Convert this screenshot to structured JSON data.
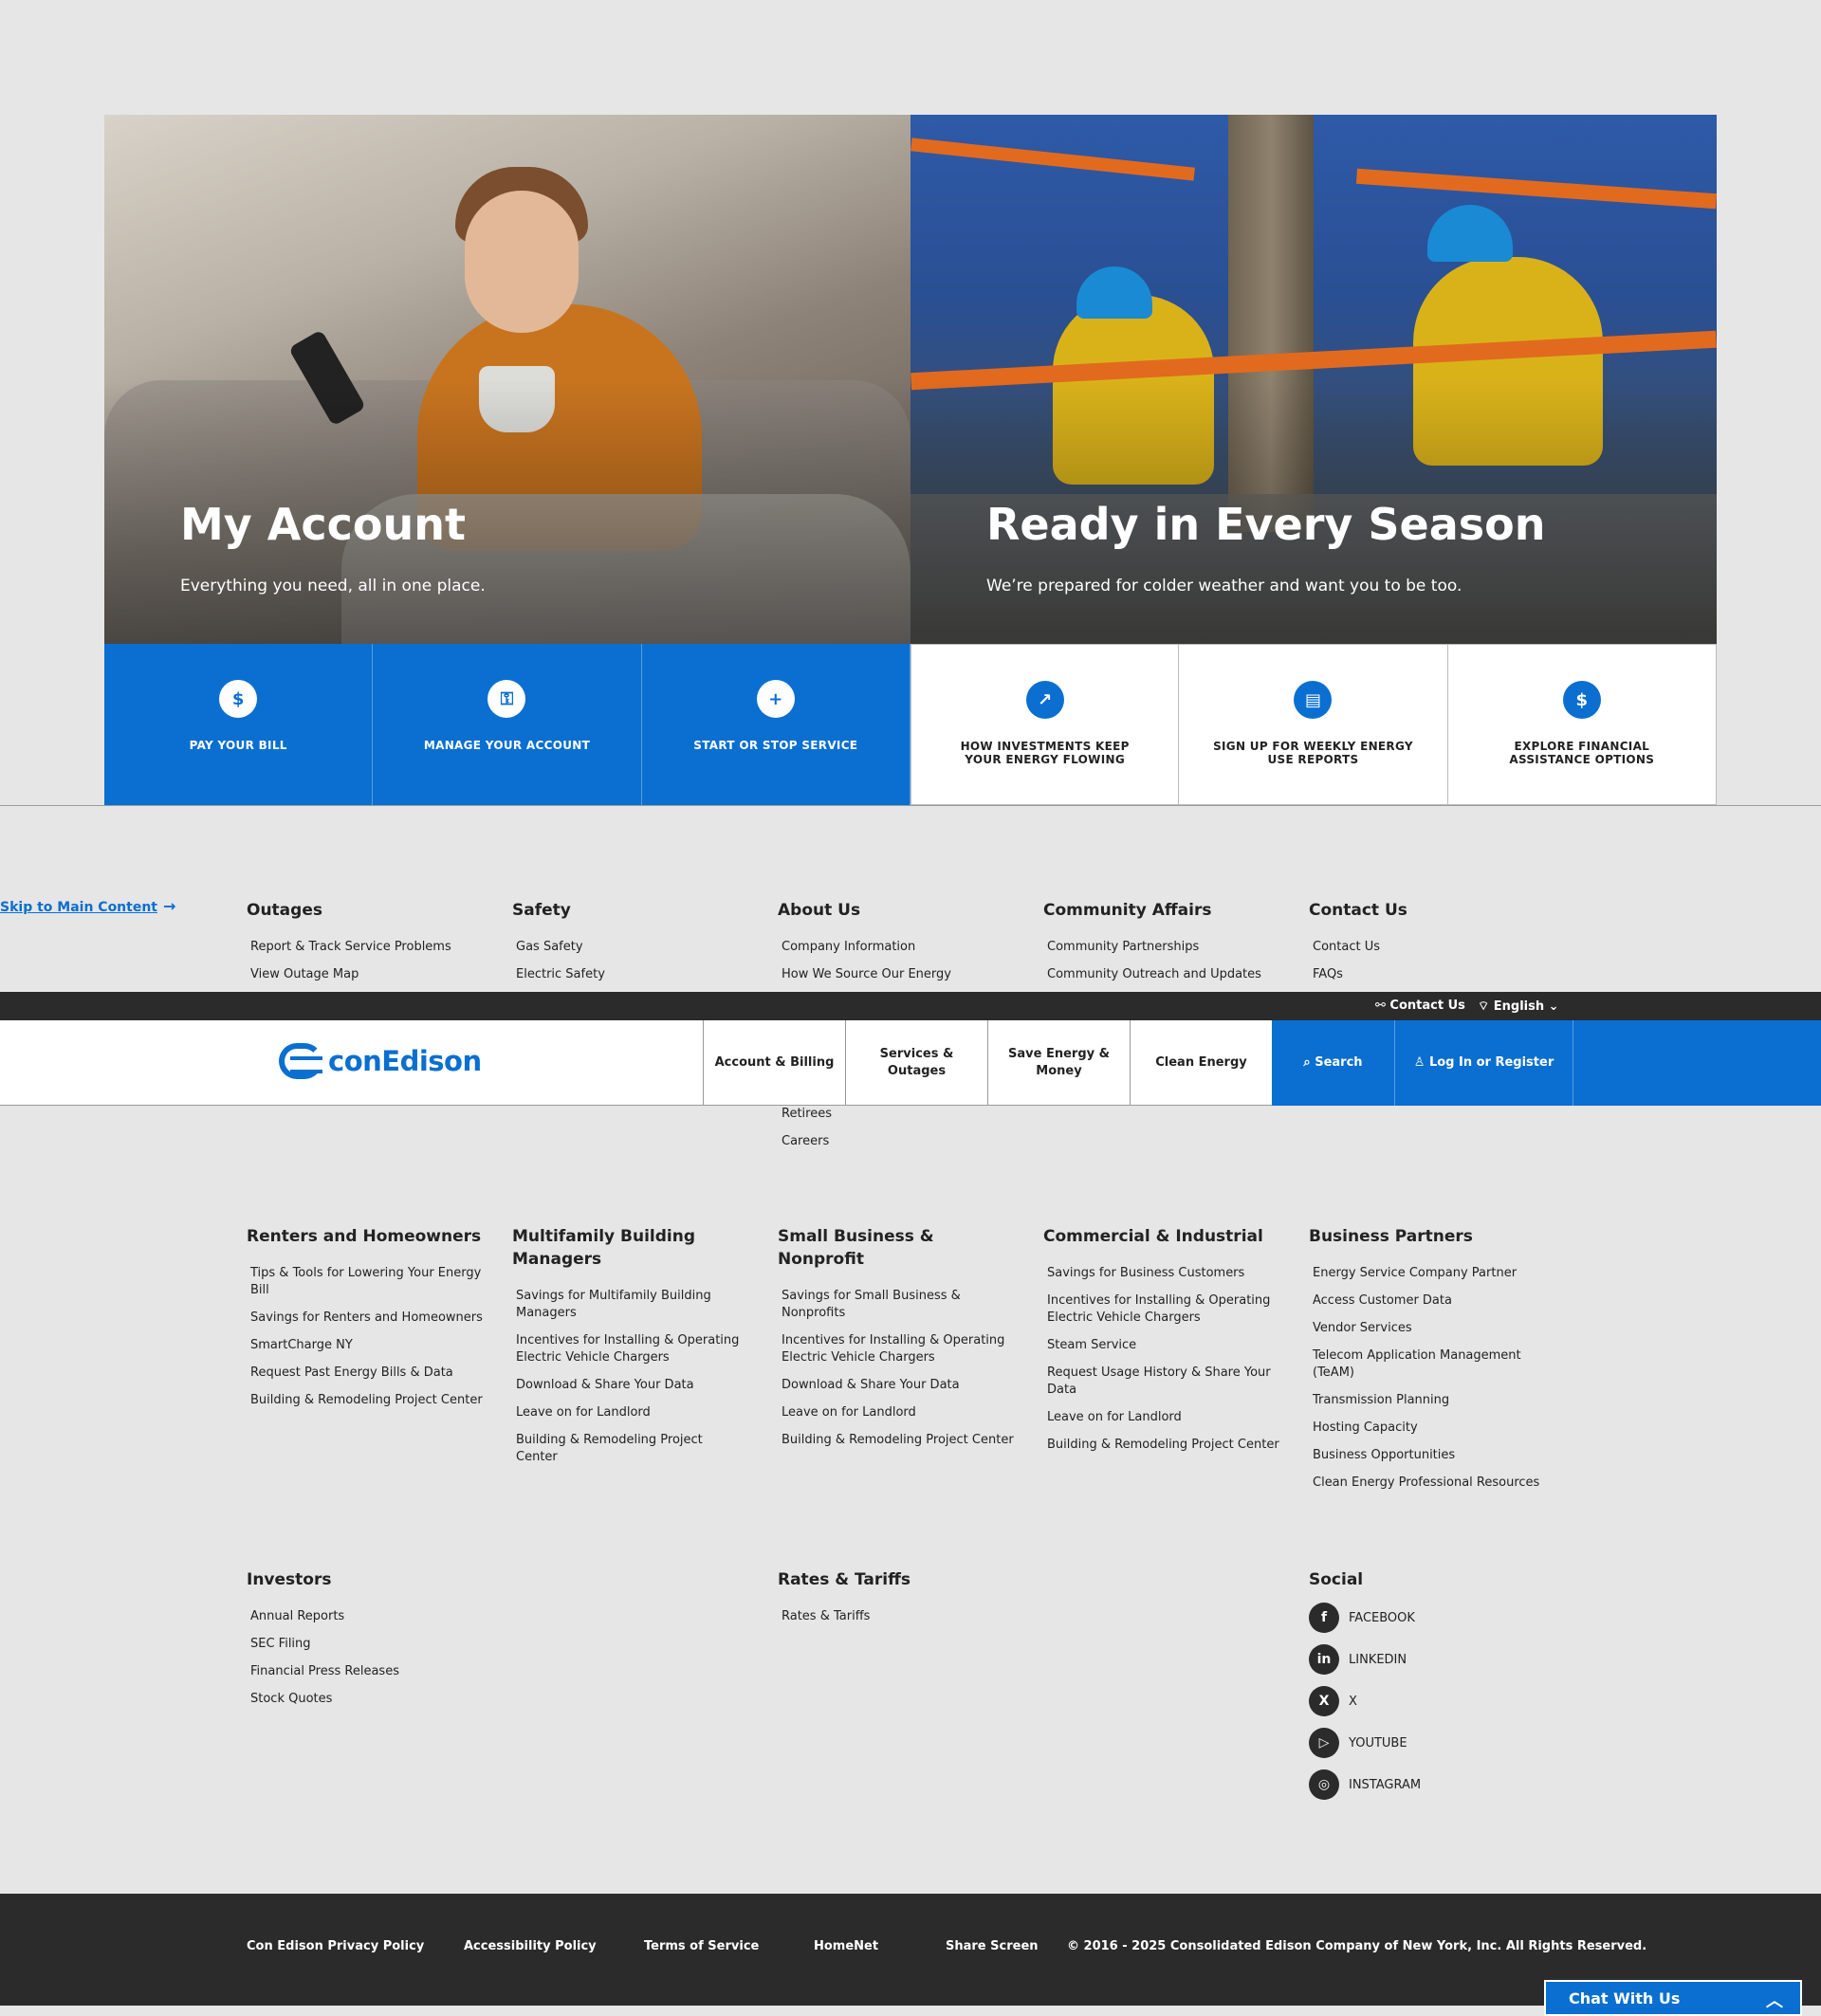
{
  "hero": {
    "left": {
      "title": "My Account",
      "subtitle": "Everything you need, all in one place."
    },
    "right": {
      "title": "Ready in Every Season",
      "subtitle": "We’re prepared for colder weather and want you to be too."
    }
  },
  "tiles": [
    {
      "label": "PAY YOUR BILL",
      "icon": "bill-icon",
      "glyph": "$"
    },
    {
      "label": "MANAGE YOUR ACCOUNT",
      "icon": "lock-icon",
      "glyph": "⚿"
    },
    {
      "label": "START OR STOP SERVICE",
      "icon": "plus-icon",
      "glyph": "+"
    },
    {
      "label": "HOW INVESTMENTS KEEP YOUR ENERGY FLOWING",
      "icon": "trend-up-icon",
      "glyph": "↗"
    },
    {
      "label": "SIGN UP FOR WEEKLY ENERGY USE REPORTS",
      "icon": "report-icon",
      "glyph": "▤"
    },
    {
      "label": "EXPLORE FINANCIAL ASSISTANCE OPTIONS",
      "icon": "dollar-icon",
      "glyph": "$"
    }
  ],
  "skip_link": "Skip to Main Content",
  "utility": {
    "contact": "Contact Us",
    "language": "English"
  },
  "header": {
    "logo": "conEdison",
    "nav": [
      "Account & Billing",
      "Services & Outages",
      "Save Energy & Money",
      "Clean Energy"
    ],
    "search": "Search",
    "login": "Log In or Register"
  },
  "sitemap": {
    "outages": {
      "title": "Outages",
      "links": [
        "Report & Track Service Problems",
        "View Outage Map"
      ]
    },
    "safety": {
      "title": "Safety",
      "links": [
        "Gas Safety",
        "Electric Safety"
      ]
    },
    "about": {
      "title": "About Us",
      "links": [
        "Company Information",
        "How We Source Our Energy"
      ],
      "links_below": [
        "Retirees",
        "Careers"
      ]
    },
    "community": {
      "title": "Community Affairs",
      "links": [
        "Community Partnerships",
        "Community Outreach and Updates"
      ]
    },
    "contact": {
      "title": "Contact Us",
      "links": [
        "Contact Us",
        "FAQs"
      ]
    },
    "renters": {
      "title": "Renters and Homeowners",
      "links": [
        "Tips & Tools for Lowering Your Energy Bill",
        "Savings for Renters and Homeowners",
        "SmartCharge NY",
        "Request Past Energy Bills & Data",
        "Building & Remodeling Project Center"
      ]
    },
    "multifamily": {
      "title": "Multifamily Building Managers",
      "links": [
        "Savings for Multifamily Building Managers",
        "Incentives for Installing & Operating Electric Vehicle Chargers",
        "Download & Share Your Data",
        "Leave on for Landlord",
        "Building & Remodeling Project Center"
      ]
    },
    "smallbiz": {
      "title": "Small Business & Nonprofit",
      "links": [
        "Savings for Small Business & Nonprofits",
        "Incentives for Installing & Operating Electric Vehicle Chargers",
        "Download & Share Your Data",
        "Leave on for Landlord",
        "Building & Remodeling Project Center"
      ]
    },
    "commercial": {
      "title": "Commercial & Industrial",
      "links": [
        "Savings for Business Customers",
        "Incentives for Installing & Operating Electric Vehicle Chargers",
        "Steam Service",
        "Request Usage History & Share Your Data",
        "Leave on for Landlord",
        "Building & Remodeling Project Center"
      ]
    },
    "partners": {
      "title": "Business Partners",
      "links": [
        "Energy Service Company Partner",
        "Access Customer Data",
        "Vendor Services",
        "Telecom Application Management (TeAM)",
        "Transmission Planning",
        "Hosting Capacity",
        "Business Opportunities",
        "Clean Energy Professional Resources"
      ]
    },
    "investors": {
      "title": "Investors",
      "links": [
        "Annual Reports",
        "SEC Filing",
        "Financial Press Releases",
        "Stock Quotes"
      ]
    },
    "rates": {
      "title": "Rates & Tariffs",
      "links": [
        "Rates & Tariffs"
      ]
    }
  },
  "social": {
    "title": "Social",
    "items": [
      {
        "label": "FACEBOOK",
        "glyph": "f",
        "icon": "facebook-icon"
      },
      {
        "label": "LINKEDIN",
        "glyph": "in",
        "icon": "linkedin-icon"
      },
      {
        "label": "X",
        "glyph": "X",
        "icon": "x-icon"
      },
      {
        "label": "YOUTUBE",
        "glyph": "▷",
        "icon": "youtube-icon"
      },
      {
        "label": "INSTAGRAM",
        "glyph": "◎",
        "icon": "instagram-icon"
      }
    ]
  },
  "footer": {
    "links": [
      "Con Edison Privacy Policy",
      "Accessibility Policy",
      "Terms of Service",
      "HomeNet",
      "Share Screen"
    ],
    "copyright": "© 2016 - 2025 Consolidated Edison Company of New York, Inc. All Rights Reserved."
  },
  "chat": "Chat With Us",
  "colors": {
    "brand_blue": "#0a6fd0",
    "dark": "#2b2b2b",
    "background": "#e6e6e6"
  }
}
